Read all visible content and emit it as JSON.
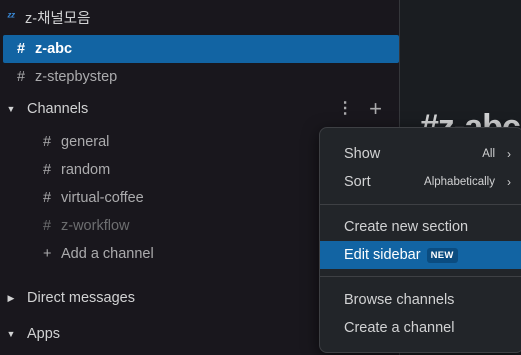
{
  "sidebar": {
    "korean_section": "z-채널모음",
    "zz_icon": "zz-icon",
    "channels_top": [
      {
        "label": "z-abc",
        "selected": true
      },
      {
        "label": "z-stepbystep",
        "selected": false
      }
    ],
    "channels_section": "Channels",
    "channels": [
      {
        "label": "general"
      },
      {
        "label": "random"
      },
      {
        "label": "virtual-coffee"
      },
      {
        "label": "z-workflow"
      }
    ],
    "add_channel": "Add a channel",
    "direct_messages": "Direct messages",
    "apps": "Apps",
    "hash": "#",
    "plus": "+"
  },
  "main_peek": "#z-abc",
  "menu": {
    "show_label": "Show",
    "show_value": "All",
    "sort_label": "Sort",
    "sort_value": "Alphabetically",
    "create_section": "Create new section",
    "edit_sidebar": "Edit sidebar",
    "new_badge": "NEW",
    "browse_channels": "Browse channels",
    "create_channel": "Create a channel"
  },
  "colors": {
    "accent": "#1264a3",
    "background": "#19171d",
    "menu_bg": "#222529"
  }
}
